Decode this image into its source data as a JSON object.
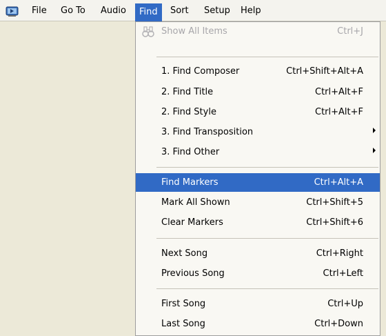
{
  "menubar": {
    "items": [
      "File",
      "Go To",
      "Audio",
      "Find",
      "Sort",
      "Setup",
      "Help"
    ],
    "open_menu": "Find"
  },
  "find_menu": {
    "show_all": {
      "label": "Show All Items",
      "shortcut": "Ctrl+J",
      "enabled": false
    },
    "find_composer": {
      "label": "1. Find Composer",
      "shortcut": "Ctrl+Shift+Alt+A"
    },
    "find_title": {
      "label": "2. Find Title",
      "shortcut": "Ctrl+Alt+F"
    },
    "find_style": {
      "label": "2. Find Style",
      "shortcut": "Ctrl+Alt+F"
    },
    "find_transposition": {
      "label": "3. Find Transposition",
      "submenu": true
    },
    "find_other": {
      "label": "3. Find Other",
      "submenu": true
    },
    "find_markers": {
      "label": "Find Markers",
      "shortcut": "Ctrl+Alt+A",
      "highlighted": true
    },
    "mark_all_shown": {
      "label": "Mark All Shown",
      "shortcut": "Ctrl+Shift+5"
    },
    "clear_markers": {
      "label": "Clear Markers",
      "shortcut": "Ctrl+Shift+6"
    },
    "next_song": {
      "label": "Next Song",
      "shortcut": "Ctrl+Right"
    },
    "previous_song": {
      "label": "Previous Song",
      "shortcut": "Ctrl+Left"
    },
    "first_song": {
      "label": "First Song",
      "shortcut": "Ctrl+Up"
    },
    "last_song": {
      "label": "Last Song",
      "shortcut": "Ctrl+Down"
    }
  },
  "colors": {
    "highlight": "#316ac5",
    "disabled_text": "#a7a6aa",
    "menu_background": "#f9f8f3"
  }
}
